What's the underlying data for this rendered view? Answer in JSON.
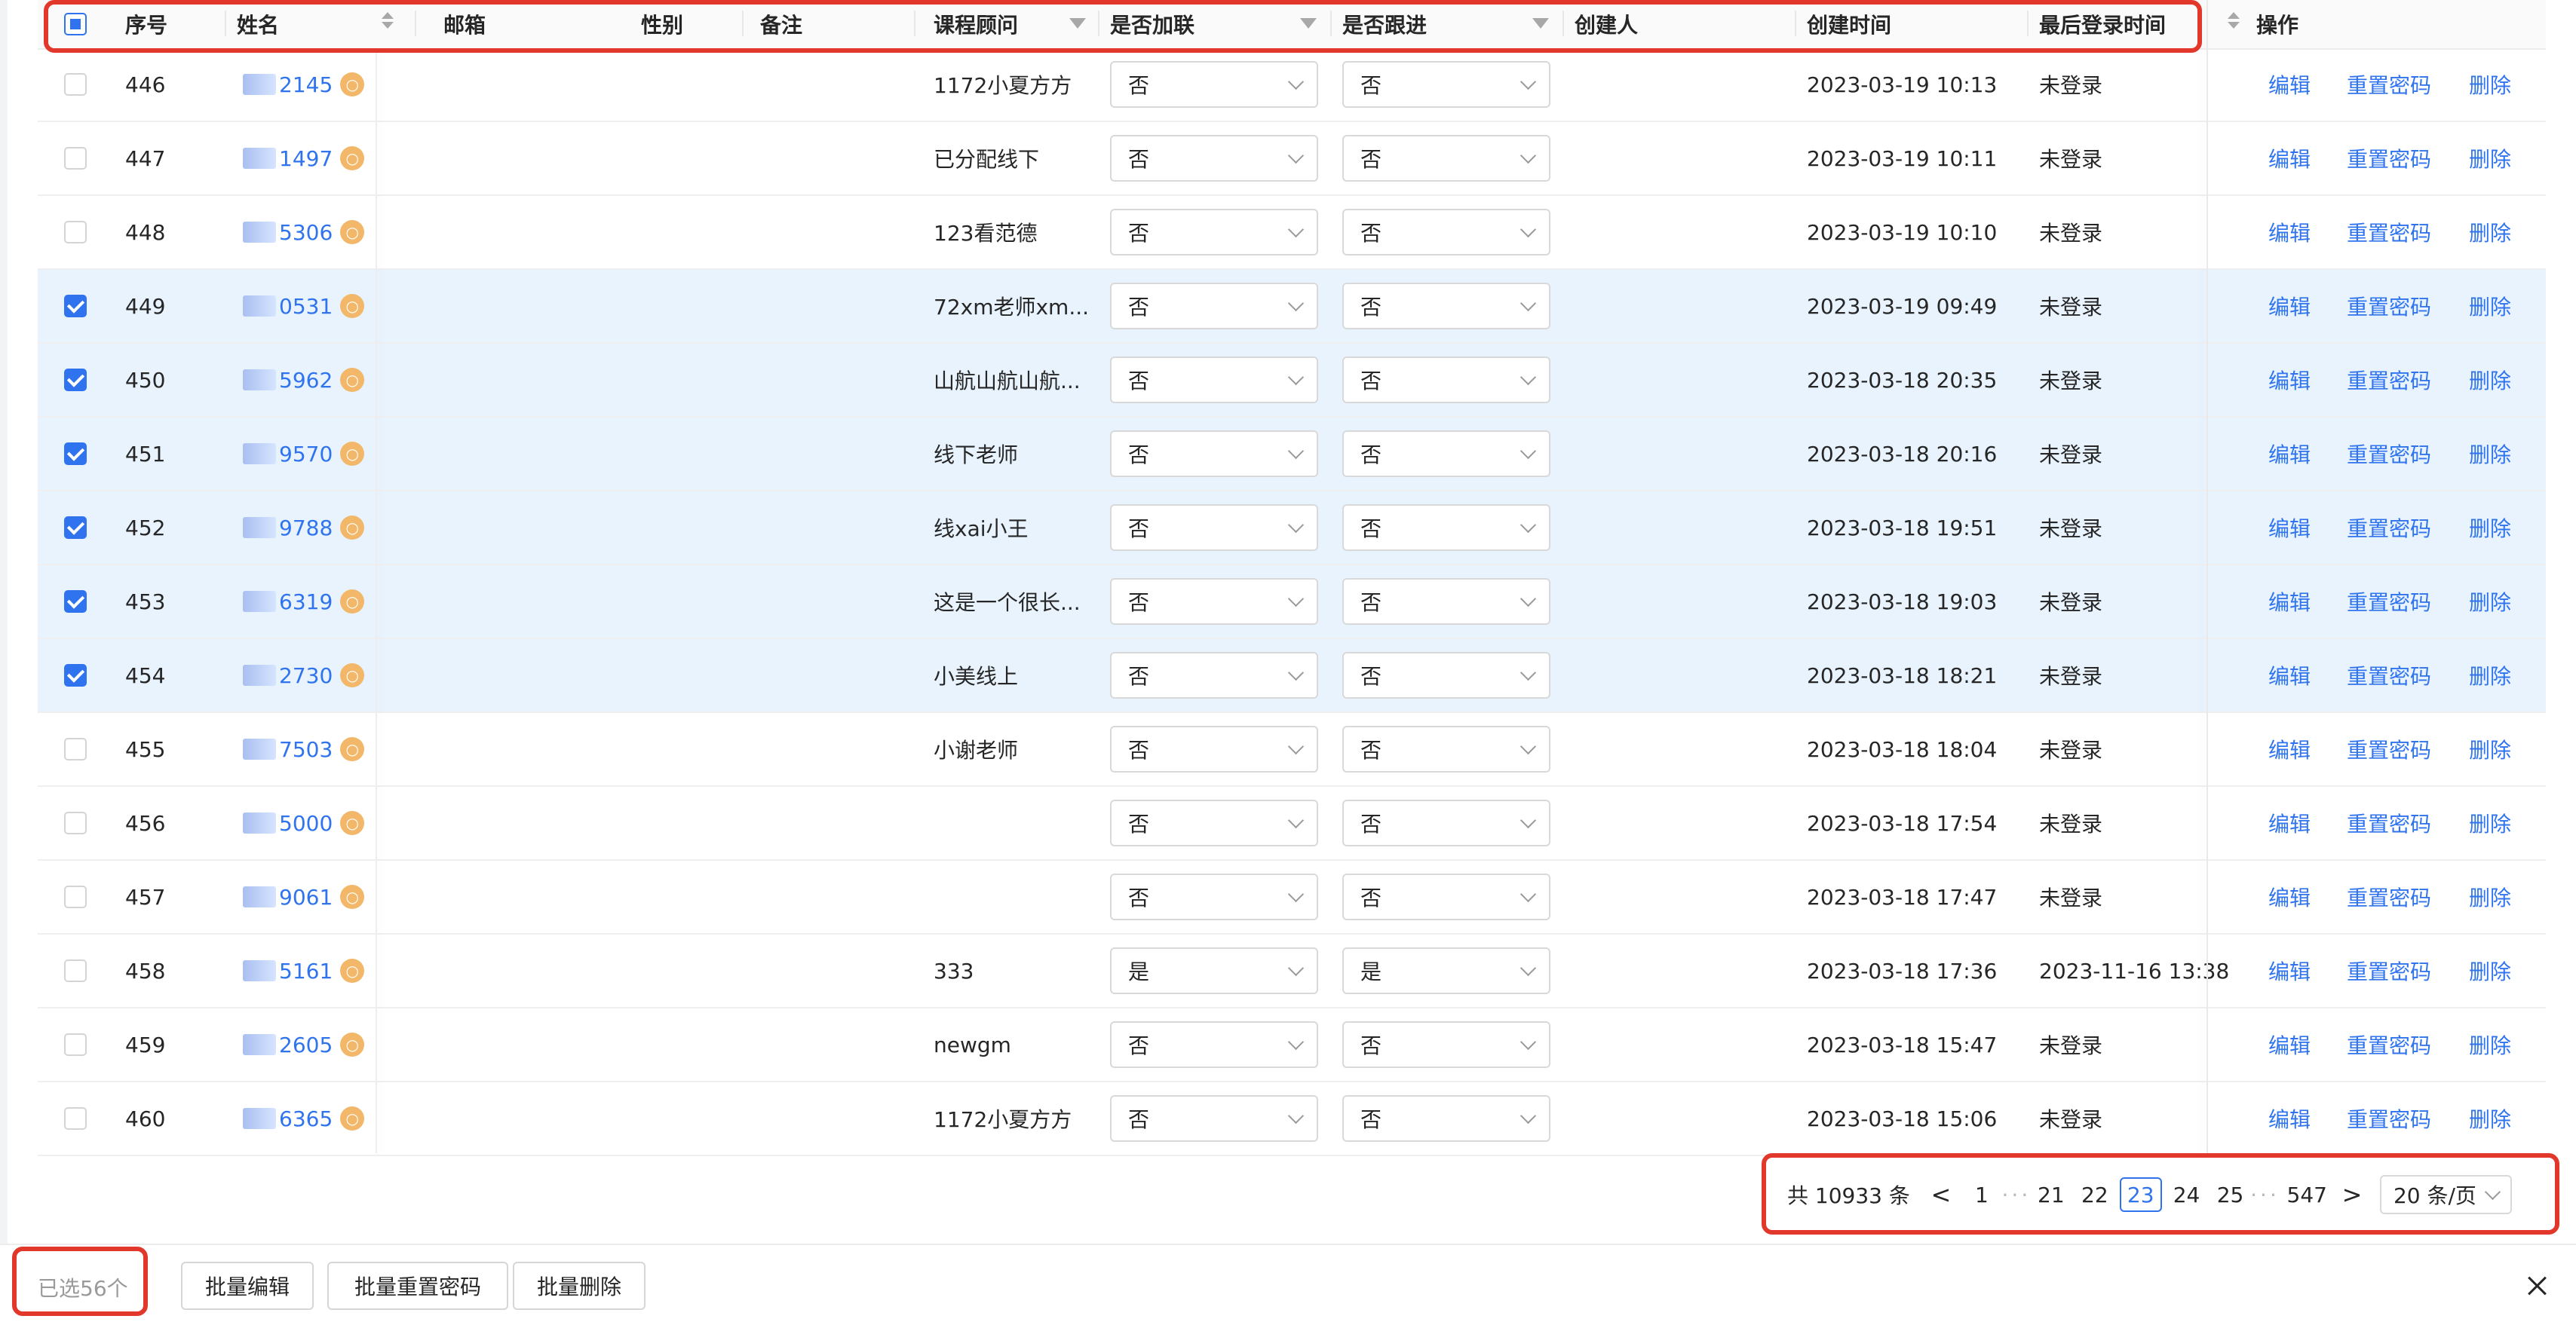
{
  "columns": {
    "index": "序号",
    "name": "姓名",
    "email": "邮箱",
    "gender": "性别",
    "remark": "备注",
    "advisor": "课程顾问",
    "joined": "是否加联",
    "followed": "是否跟进",
    "creator": "创建人",
    "created_at": "创建时间",
    "last_login": "最后登录时间",
    "actions": "操作"
  },
  "action_labels": {
    "edit": "编辑",
    "reset": "重置密码",
    "delete": "删除"
  },
  "rows": [
    {
      "index": "446",
      "name": "2145",
      "advisor": "1172小夏方方",
      "joined": "否",
      "followed": "否",
      "created_at": "2023-03-19 10:13",
      "last_login": "未登录",
      "selected": false
    },
    {
      "index": "447",
      "name": "1497",
      "advisor": "已分配线下",
      "joined": "否",
      "followed": "否",
      "created_at": "2023-03-19 10:11",
      "last_login": "未登录",
      "selected": false
    },
    {
      "index": "448",
      "name": "5306",
      "advisor": "123看范德",
      "joined": "否",
      "followed": "否",
      "created_at": "2023-03-19 10:10",
      "last_login": "未登录",
      "selected": false
    },
    {
      "index": "449",
      "name": "0531",
      "advisor": "72xm老师xm...",
      "joined": "否",
      "followed": "否",
      "created_at": "2023-03-19 09:49",
      "last_login": "未登录",
      "selected": true
    },
    {
      "index": "450",
      "name": "5962",
      "advisor": "山航山航山航...",
      "joined": "否",
      "followed": "否",
      "created_at": "2023-03-18 20:35",
      "last_login": "未登录",
      "selected": true
    },
    {
      "index": "451",
      "name": "9570",
      "advisor": "线下老师",
      "joined": "否",
      "followed": "否",
      "created_at": "2023-03-18 20:16",
      "last_login": "未登录",
      "selected": true
    },
    {
      "index": "452",
      "name": "9788",
      "advisor": "线xai小王",
      "joined": "否",
      "followed": "否",
      "created_at": "2023-03-18 19:51",
      "last_login": "未登录",
      "selected": true
    },
    {
      "index": "453",
      "name": "6319",
      "advisor": "这是一个很长...",
      "joined": "否",
      "followed": "否",
      "created_at": "2023-03-18 19:03",
      "last_login": "未登录",
      "selected": true
    },
    {
      "index": "454",
      "name": "2730",
      "advisor": "小美线上",
      "joined": "否",
      "followed": "否",
      "created_at": "2023-03-18 18:21",
      "last_login": "未登录",
      "selected": true
    },
    {
      "index": "455",
      "name": "7503",
      "advisor": "小谢老师",
      "joined": "否",
      "followed": "否",
      "created_at": "2023-03-18 18:04",
      "last_login": "未登录",
      "selected": false
    },
    {
      "index": "456",
      "name": "5000",
      "advisor": "",
      "joined": "否",
      "followed": "否",
      "created_at": "2023-03-18 17:54",
      "last_login": "未登录",
      "selected": false
    },
    {
      "index": "457",
      "name": "9061",
      "advisor": "",
      "joined": "否",
      "followed": "否",
      "created_at": "2023-03-18 17:47",
      "last_login": "未登录",
      "selected": false
    },
    {
      "index": "458",
      "name": "5161",
      "advisor": "333",
      "joined": "是",
      "followed": "是",
      "created_at": "2023-03-18 17:36",
      "last_login": "2023-11-16 13:38",
      "selected": false
    },
    {
      "index": "459",
      "name": "2605",
      "advisor": "newgm",
      "joined": "否",
      "followed": "否",
      "created_at": "2023-03-18 15:47",
      "last_login": "未登录",
      "selected": false
    },
    {
      "index": "460",
      "name": "6365",
      "advisor": "1172小夏方方",
      "joined": "否",
      "followed": "否",
      "created_at": "2023-03-18 15:06",
      "last_login": "未登录",
      "selected": false
    }
  ],
  "pagination": {
    "total": "共 10933 条",
    "pages": [
      "1",
      "21",
      "22",
      "23",
      "24",
      "25",
      "547"
    ],
    "current": "23",
    "dots": "···",
    "prev": "<",
    "next": ">",
    "page_size": "20 条/页"
  },
  "footer": {
    "selected_count": "已选56个",
    "batch_edit": "批量编辑",
    "batch_reset": "批量重置密码",
    "batch_delete": "批量删除"
  },
  "colors": {
    "primary": "#2f74ee",
    "highlight": "#e2382c",
    "selected_row": "#e8f3fe"
  }
}
